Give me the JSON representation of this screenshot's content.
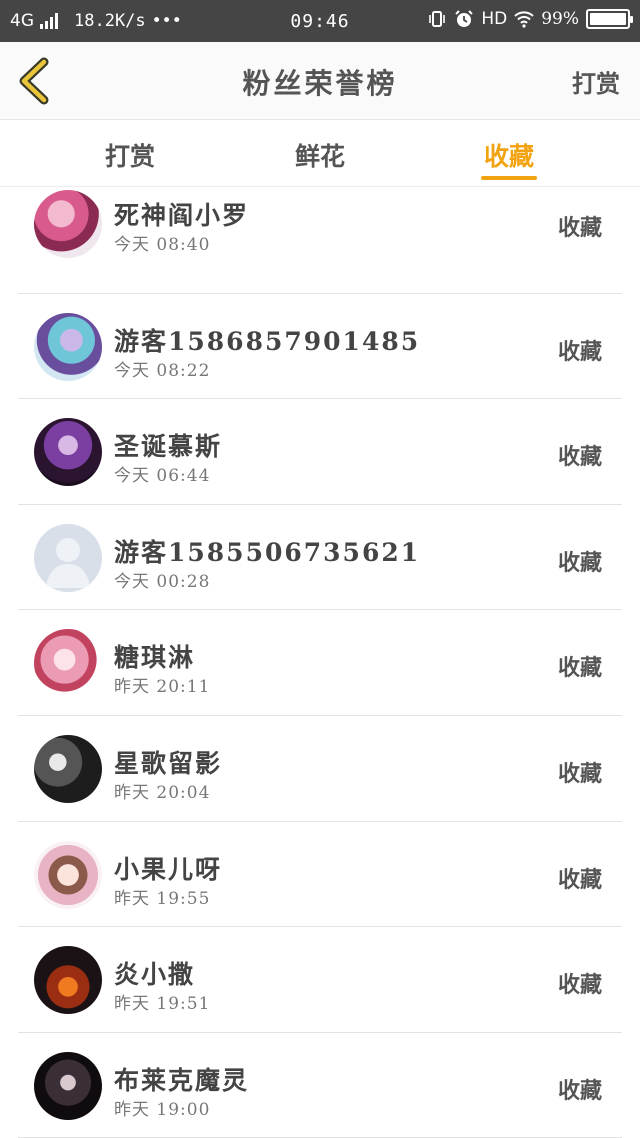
{
  "status_bar": {
    "network": "4G",
    "speed": "18.2K/s",
    "dots": "•••",
    "time": "09:46",
    "hd": "HD",
    "battery_text": "99%",
    "battery_level": 0.99
  },
  "header": {
    "title": "粉丝荣誉榜",
    "right_action": "打赏",
    "back_icon": "chevron-left-icon",
    "accent_color": "#f2a311"
  },
  "tabs": [
    {
      "label": "打赏"
    },
    {
      "label": "鲜花"
    },
    {
      "label": "收藏"
    }
  ],
  "active_tab": "收藏",
  "fans": [
    {
      "name": "死神阎小罗",
      "time": "今天 08:40",
      "badge": "收藏"
    },
    {
      "name": "游客1586857901485",
      "time": "今天 08:22",
      "badge": "收藏"
    },
    {
      "name": "圣诞慕斯",
      "time": "今天 06:44",
      "badge": "收藏"
    },
    {
      "name": "游客1585506735621",
      "time": "今天 00:28",
      "badge": "收藏"
    },
    {
      "name": "糖琪淋",
      "time": "昨天 20:11",
      "badge": "收藏"
    },
    {
      "name": "星歌留影",
      "time": "昨天 20:04",
      "badge": "收藏"
    },
    {
      "name": "小果儿呀",
      "time": "昨天 19:55",
      "badge": "收藏"
    },
    {
      "name": "炎小撒",
      "time": "昨天 19:51",
      "badge": "收藏"
    },
    {
      "name": "布莱克魔灵",
      "time": "昨天 19:00",
      "badge": "收藏"
    }
  ]
}
